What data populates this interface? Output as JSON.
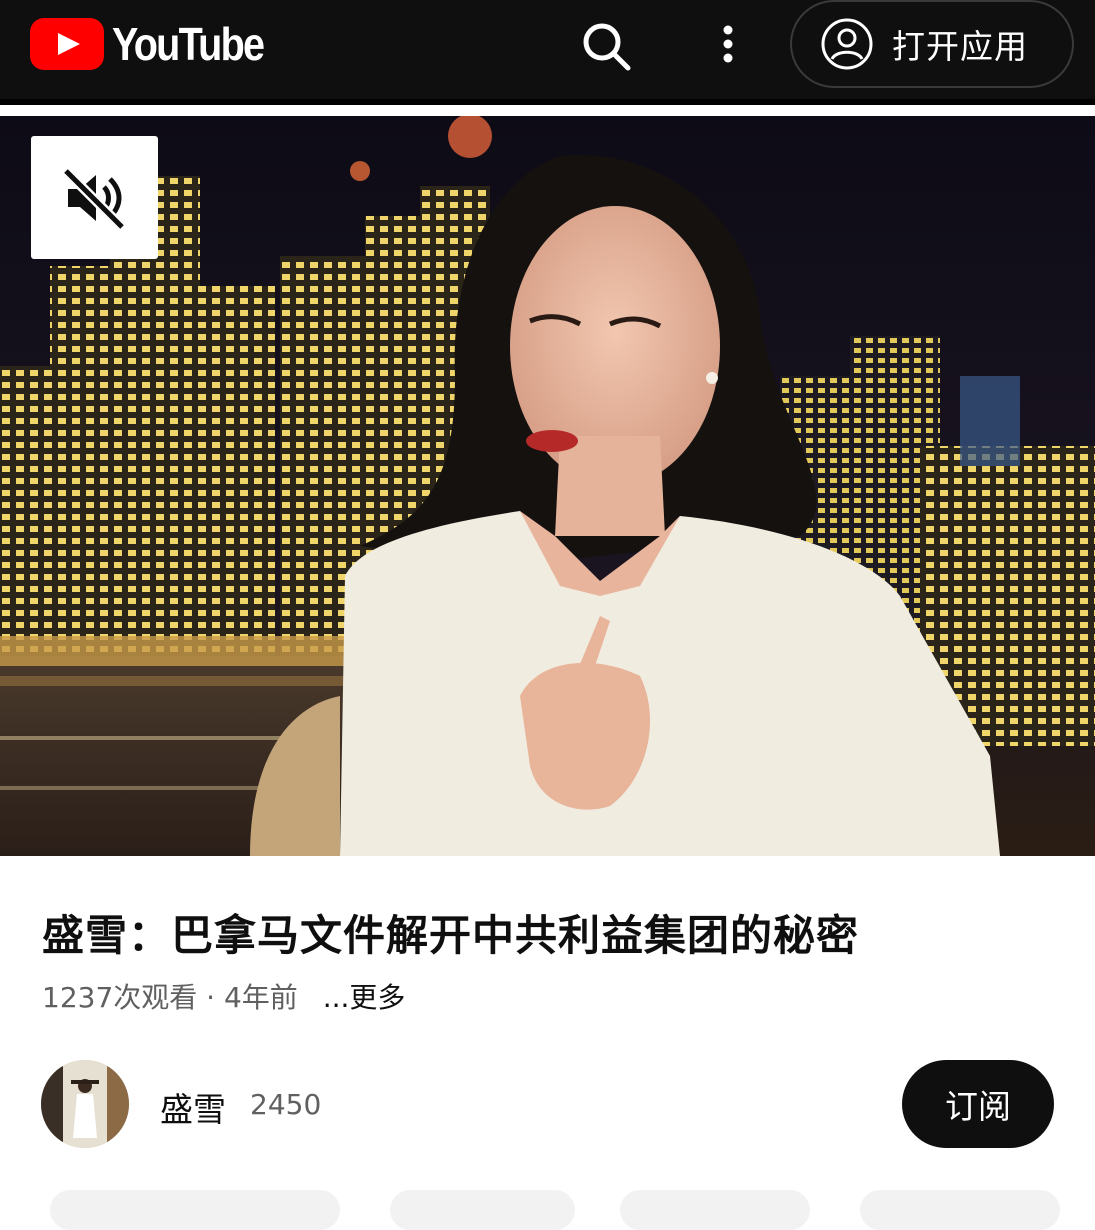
{
  "header": {
    "logo_text": "YouTube",
    "open_app_label": "打开应用",
    "brand_color": "#ff0000",
    "bar_color": "#0f0f0f"
  },
  "icons": {
    "search": "search-icon",
    "more": "more-vert-icon",
    "account": "account-circle-icon",
    "mute": "volume-off-icon"
  },
  "video": {
    "title": "盛雪：巴拿马文件解开中共利益集团的秘密",
    "meta": "1237次观看 · 4年前",
    "more_label": "...更多"
  },
  "channel": {
    "name": "盛雪",
    "subscribers": "2450",
    "subscribe_label": "订阅"
  }
}
